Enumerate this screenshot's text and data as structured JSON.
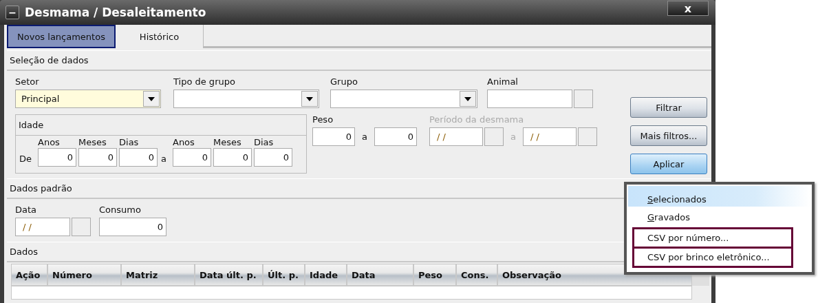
{
  "window": {
    "title": "Desmama / Desaleitamento",
    "minimize": "−",
    "close": "x"
  },
  "tabs": [
    {
      "label": "Novos lançamentos",
      "selected": true
    },
    {
      "label": "Histórico",
      "selected": false
    }
  ],
  "selection": {
    "title": "Seleção de dados",
    "fields": [
      {
        "label": "Setor",
        "kind": "combo",
        "value": "Principal",
        "focused": true
      },
      {
        "label": "Tipo de grupo",
        "kind": "combo",
        "focused": false
      },
      {
        "label": "Grupo",
        "kind": "combo",
        "focused": false
      },
      {
        "label": "Animal",
        "kind": "lookup",
        "focused": false
      }
    ],
    "idade": {
      "title": "Idade",
      "from_label": "De",
      "separator": "a",
      "from": [
        {
          "unit": "Anos",
          "value": "0"
        },
        {
          "unit": "Meses",
          "value": "0"
        },
        {
          "unit": "Dias",
          "value": "0"
        }
      ],
      "to": [
        {
          "unit": "Anos",
          "value": "0"
        },
        {
          "unit": "Meses",
          "value": "0"
        },
        {
          "unit": "Dias",
          "value": "0"
        }
      ]
    },
    "peso": {
      "label": "Peso",
      "from": "0",
      "separator": "a",
      "to": "0",
      "disabled": false
    },
    "periodo": {
      "label": "Período da desmama",
      "from": "/ /",
      "separator": "a",
      "to": "/ /",
      "disabled": true
    },
    "buttons": [
      {
        "label": "Filtrar",
        "active": false
      },
      {
        "label": "Mais filtros...",
        "active": false
      },
      {
        "label": "Aplicar",
        "active": true
      }
    ]
  },
  "defaults": {
    "title": "Dados padrão",
    "data": {
      "label": "Data",
      "value": "/ /"
    },
    "consumo": {
      "label": "Consumo",
      "value": "0"
    }
  },
  "data": {
    "title": "Dados",
    "columns": [
      "Ação",
      "Número",
      "Matriz",
      "Data últ. p.",
      "Últ. p.",
      "Idade",
      "Data",
      "Peso",
      "Cons.",
      "Observação"
    ]
  },
  "menu": {
    "items": [
      {
        "label": "Selecionados",
        "selected": true,
        "mnemonic": true,
        "marked": false
      },
      {
        "label": "Gravados",
        "selected": false,
        "mnemonic": true,
        "marked": false
      },
      {
        "label": "CSV por número...",
        "selected": false,
        "mnemonic": false,
        "marked": true
      },
      {
        "label": "CSV por brinco eletrônico...",
        "selected": false,
        "mnemonic": false,
        "marked": true
      }
    ]
  }
}
